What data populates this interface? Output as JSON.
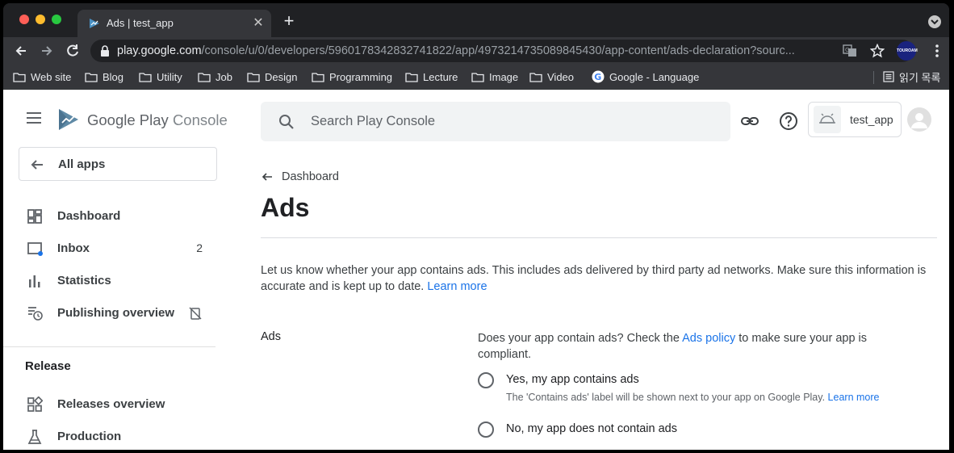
{
  "browser": {
    "tab_title": "Ads | test_app",
    "url_host": "play.google.com",
    "url_path": "/console/u/0/developers/5960178342832741822/app/4973214735089845430/app-content/ads-declaration?sourc...",
    "profile_badge": "TOUROAM",
    "bookmarks": [
      "Web site",
      "Blog",
      "Utility",
      "Job",
      "Design",
      "Programming",
      "Lecture",
      "Image",
      "Video"
    ],
    "google_bookmark": "Google - Language",
    "reading_list": "읽기 목록"
  },
  "console": {
    "brand": "Google Play",
    "brand_suffix": "Console",
    "search_placeholder": "Search Play Console",
    "app_name": "test_app"
  },
  "sidebar": {
    "all_apps": "All apps",
    "items": [
      {
        "label": "Dashboard",
        "icon": "dashboard-icon"
      },
      {
        "label": "Inbox",
        "icon": "inbox-icon",
        "count": "2"
      },
      {
        "label": "Statistics",
        "icon": "bar-chart-icon"
      },
      {
        "label": "Publishing overview",
        "icon": "schedule-list-icon"
      }
    ],
    "release_title": "Release",
    "release_items": [
      {
        "label": "Releases overview",
        "icon": "releases-grid-icon"
      },
      {
        "label": "Production",
        "icon": "production-flask-icon"
      }
    ]
  },
  "main": {
    "breadcrumb": "Dashboard",
    "title": "Ads",
    "description": "Let us know whether your app contains ads. This includes ads delivered by third party ad networks. Make sure this information is accurate and is kept up to date.",
    "learn_more": "Learn more",
    "form_label": "Ads",
    "question_pre": "Does your app contain ads? Check the",
    "question_link": "Ads policy",
    "question_post": "to make sure your app is compliant.",
    "option_yes": "Yes, my app contains ads",
    "option_yes_sub": "The 'Contains ads' label will be shown next to your app on Google Play.",
    "option_yes_link": "Learn more",
    "option_no": "No, my app does not contain ads"
  },
  "colors": {
    "accent": "#1a73e8",
    "browser_chrome": "#35363a",
    "text": "#3c4043"
  }
}
